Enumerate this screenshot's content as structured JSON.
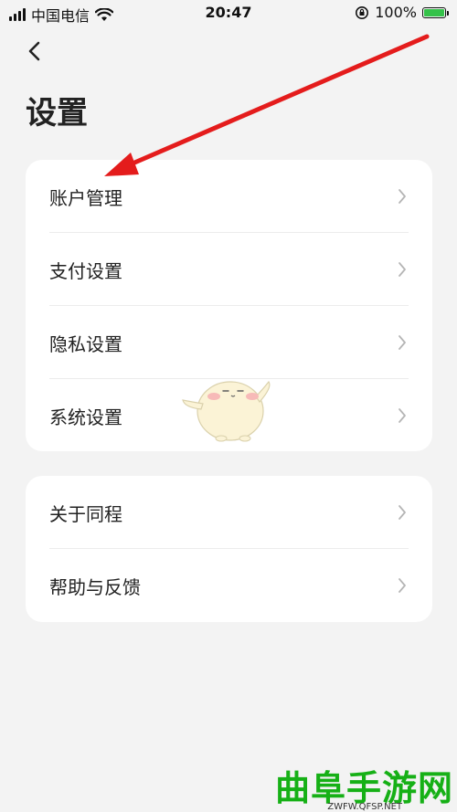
{
  "status_bar": {
    "carrier": "中国电信",
    "time": "20:47",
    "battery_percent": "100%",
    "battery_level": 1.0,
    "battery_color": "#35c24a"
  },
  "header": {
    "back_icon": "chevron-left-icon",
    "title": "设置"
  },
  "groups": [
    {
      "items": [
        {
          "label": "账户管理",
          "icon": "chevron-right-icon"
        },
        {
          "label": "支付设置",
          "icon": "chevron-right-icon"
        },
        {
          "label": "隐私设置",
          "icon": "chevron-right-icon"
        },
        {
          "label": "系统设置",
          "icon": "chevron-right-icon"
        }
      ]
    },
    {
      "items": [
        {
          "label": "关于同程",
          "icon": "chevron-right-icon"
        },
        {
          "label": "帮助与反馈",
          "icon": "chevron-right-icon"
        }
      ]
    }
  ],
  "annotation": {
    "arrow_color": "#e41c1c"
  },
  "watermark": {
    "title": "曲阜手游网",
    "url": "ZWFW.QFSP.NET",
    "color": "#16b016"
  }
}
